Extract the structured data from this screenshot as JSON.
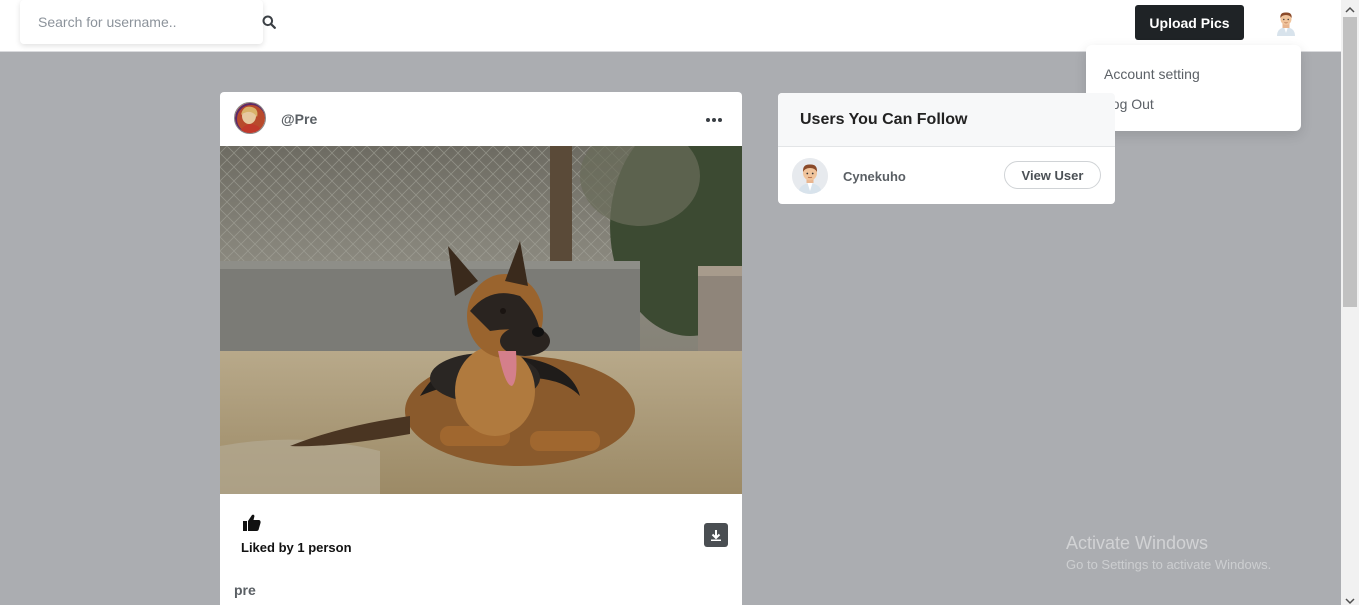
{
  "navbar": {
    "search": {
      "placeholder": "Search for username..",
      "value": ""
    },
    "search_icon": "search-icon",
    "upload_label": "Upload Pics",
    "avatar_icon": "user-avatar-icon"
  },
  "dropdown": {
    "items": [
      {
        "label": "Account setting"
      },
      {
        "label": "Log Out"
      }
    ]
  },
  "post": {
    "username": "@Pre",
    "menu_icon": "more-dots-icon",
    "image_subject": "german-shepherd-dog-photo",
    "like_icon": "thumbs-up-icon",
    "liked_text": "Liked by 1 person",
    "download_icon": "download-icon",
    "caption_user": "pre"
  },
  "suggestions": {
    "title": "Users You Can Follow",
    "users": [
      {
        "name": "Cynekuho",
        "button_label": "View User"
      }
    ]
  },
  "watermark": {
    "title": "Activate Windows",
    "subtitle": "Go to Settings to activate Windows."
  },
  "colors": {
    "page_bg": "#abadb1",
    "button_dark": "#1f2326",
    "card_bg": "#ffffff"
  }
}
